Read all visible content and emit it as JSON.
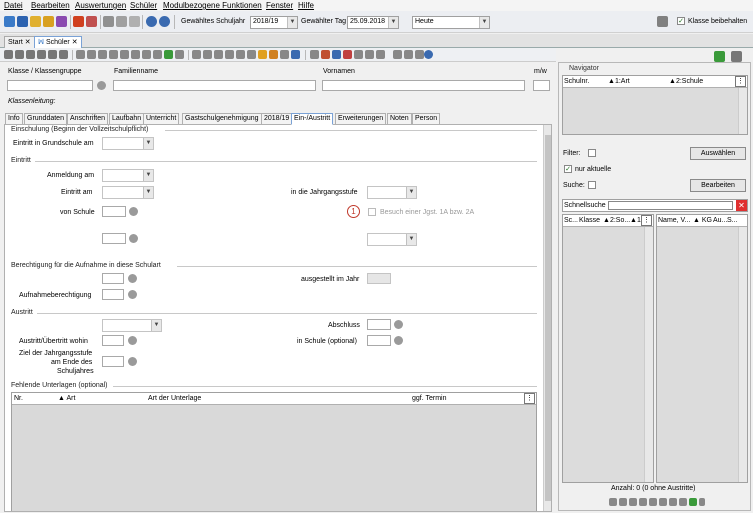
{
  "menu": [
    "Datei",
    "Bearbeiten",
    "Auswertungen",
    "Schüler",
    "Modulbezogene Funktionen",
    "Fenster",
    "Hilfe"
  ],
  "toolbar": {
    "schuljahr_label": "Gewähltes Schuljahr",
    "schuljahr_value": "2018/19",
    "tag_label": "Gewählter Tag",
    "tag_value": "25.09.2018",
    "heute_value": "Heute",
    "klasse_beibehalten": "Klasse beibehalten"
  },
  "doc_tabs": [
    {
      "label": "Start"
    },
    {
      "label": "Schüler"
    }
  ],
  "record": {
    "klasse_label": "Klasse / Klassengruppe",
    "familienname_label": "Familienname",
    "vornamen_label": "Vornamen",
    "mw_label": "m/w",
    "klassenleitung_label": "Klassenleitung:"
  },
  "form_tabs": [
    "Info",
    "Grunddaten",
    "Anschriften",
    "Laufbahn",
    "Unterricht",
    "Gastschulgenehmigung",
    "2018/19",
    "Ein-/Austritt",
    "Erweiterungen",
    "Noten",
    "Person"
  ],
  "form": {
    "einschulung_section": "Einschulung (Beginn der Vollzeitschulpflicht)",
    "eintritt_grundschule": "Eintritt in Grundschule am",
    "eintritt_section": "Eintritt",
    "anmeldung_am": "Anmeldung am",
    "eintritt_am": "Eintritt am",
    "jahrgangsstufe": "in die Jahrgangsstufe",
    "von_schule": "von Schule",
    "besuch_label": "Besuch einer Jgst. 1A bzw. 2A",
    "marker": "1",
    "berechtigung_section": "Berechtigung für die Aufnahme in diese Schulart",
    "ausgestellt": "ausgestellt im Jahr",
    "aufnahmeberechtigung": "Aufnahmeberechtigung",
    "austritt_section": "Austritt",
    "abschluss": "Abschluss",
    "austritt_wohin": "Austritt/Übertritt wohin",
    "in_schule": "in Schule (optional)",
    "ziel_line1": "Ziel der Jahrgangsstufe",
    "ziel_line2": "am Ende des",
    "ziel_line3": "Schuljahres",
    "fehlende_section": "Fehlende Unterlagen (optional)",
    "columns": [
      "Nr.",
      "Art",
      "Art der Unterlage",
      "ggf. Termin"
    ]
  },
  "navigator": {
    "title": "Navigator",
    "columns": [
      "Schulnr.",
      "1:Art",
      "2:Schule"
    ],
    "filter_label": "Filter:",
    "auswaehlen": "Auswählen",
    "nur_aktuelle": "nur aktuelle",
    "suche_label": "Suche:",
    "bearbeiten": "Bearbeiten",
    "schnellsuche": "Schnellsuche",
    "left_columns": [
      "Sc...",
      "Klasse",
      "2:So...",
      "1"
    ],
    "right_columns": [
      "Name, V...",
      "KG",
      "Au...",
      "S..."
    ],
    "anzahl": "Anzahl: 0 (0 ohne Austritte)"
  },
  "colors": {
    "accent": "#7aa2d6",
    "marker": "#c0392b",
    "green": "#3a9a3a"
  }
}
